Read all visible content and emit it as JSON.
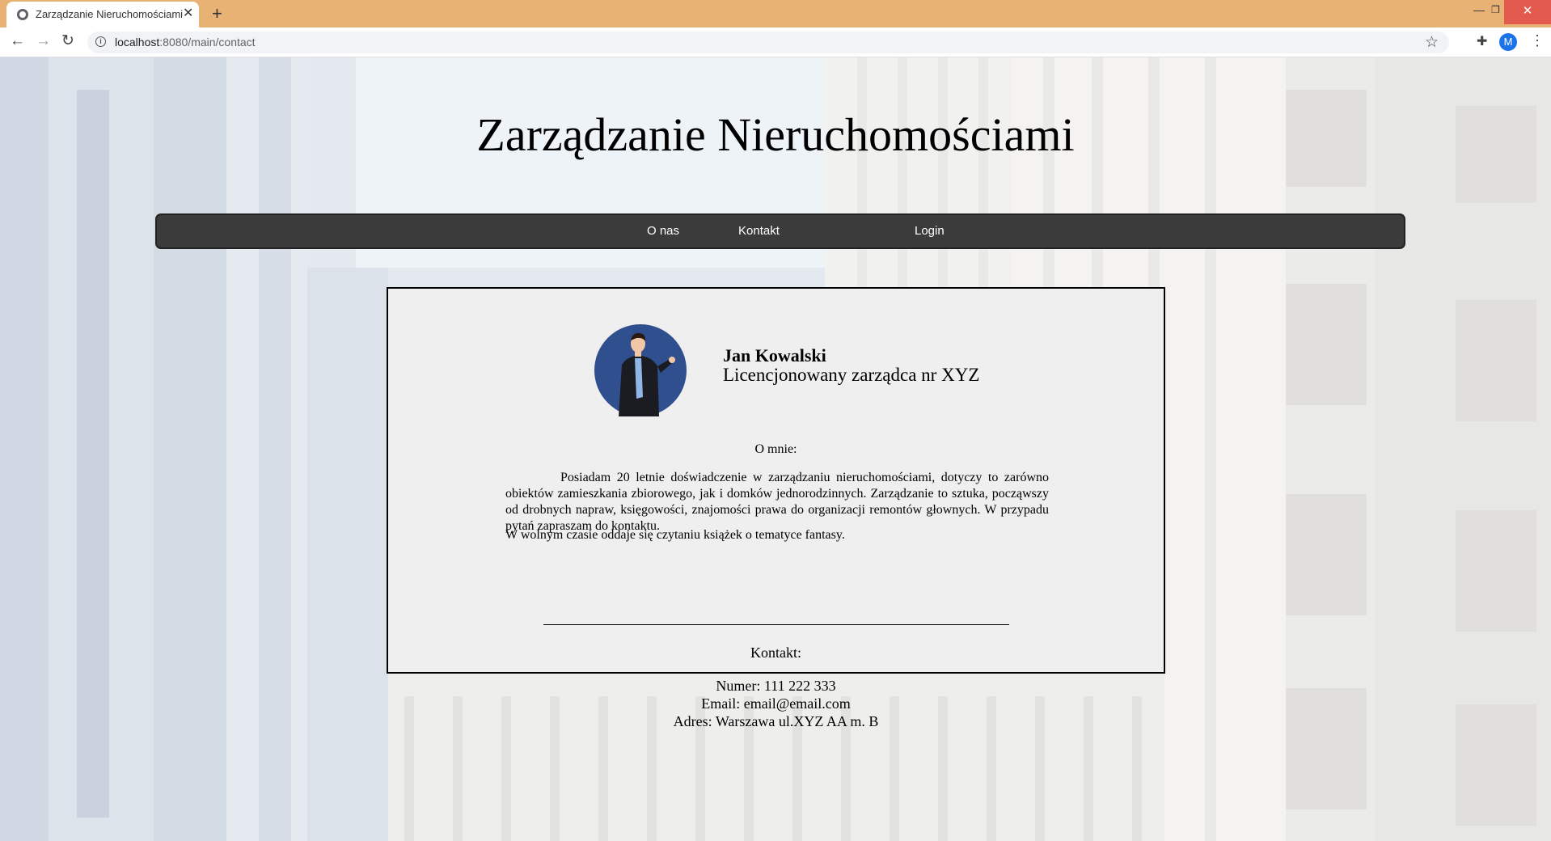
{
  "browser": {
    "tab_title": "Zarządzanie Nieruchomościami",
    "url_host": "localhost",
    "url_path": ":8080/main/contact",
    "profile_initial": "M"
  },
  "site": {
    "title": "Zarządzanie Nieruchomościami"
  },
  "nav": {
    "items": [
      {
        "label": "O nas"
      },
      {
        "label": "Kontakt"
      },
      {
        "label": "Login"
      }
    ]
  },
  "profile": {
    "name": "Jan Kowalski",
    "role": "Licencjonowany zarządca nr XYZ"
  },
  "about": {
    "heading": "O mnie:",
    "paragraph": "Posiadam 20 letnie doświadczenie w zarządzaniu nieruchomościami, dotyczy to zarówno obiektów zamieszkania zbiorowego, jak i domków jednorodzinnych. Zarządzanie to sztuka, począwszy od drobnych napraw, księgowości, znajomości prawa do organizacji remontów głownych. W przypadu pytań zapraszam do kontaktu.",
    "hobby": "W wolnym czasie oddaje się czytaniu książek o tematyce fantasy."
  },
  "contact": {
    "heading": "Kontakt:",
    "phone": "Numer: 111 222 333",
    "email": "Email: email@email.com",
    "address": "Adres: Warszawa ul.XYZ AA m. B"
  },
  "colors": {
    "browser_frame": "#e8b275",
    "navbar": "#3b3b3b",
    "card": "#efefef",
    "avatar_bg": "#2f4f8f"
  }
}
